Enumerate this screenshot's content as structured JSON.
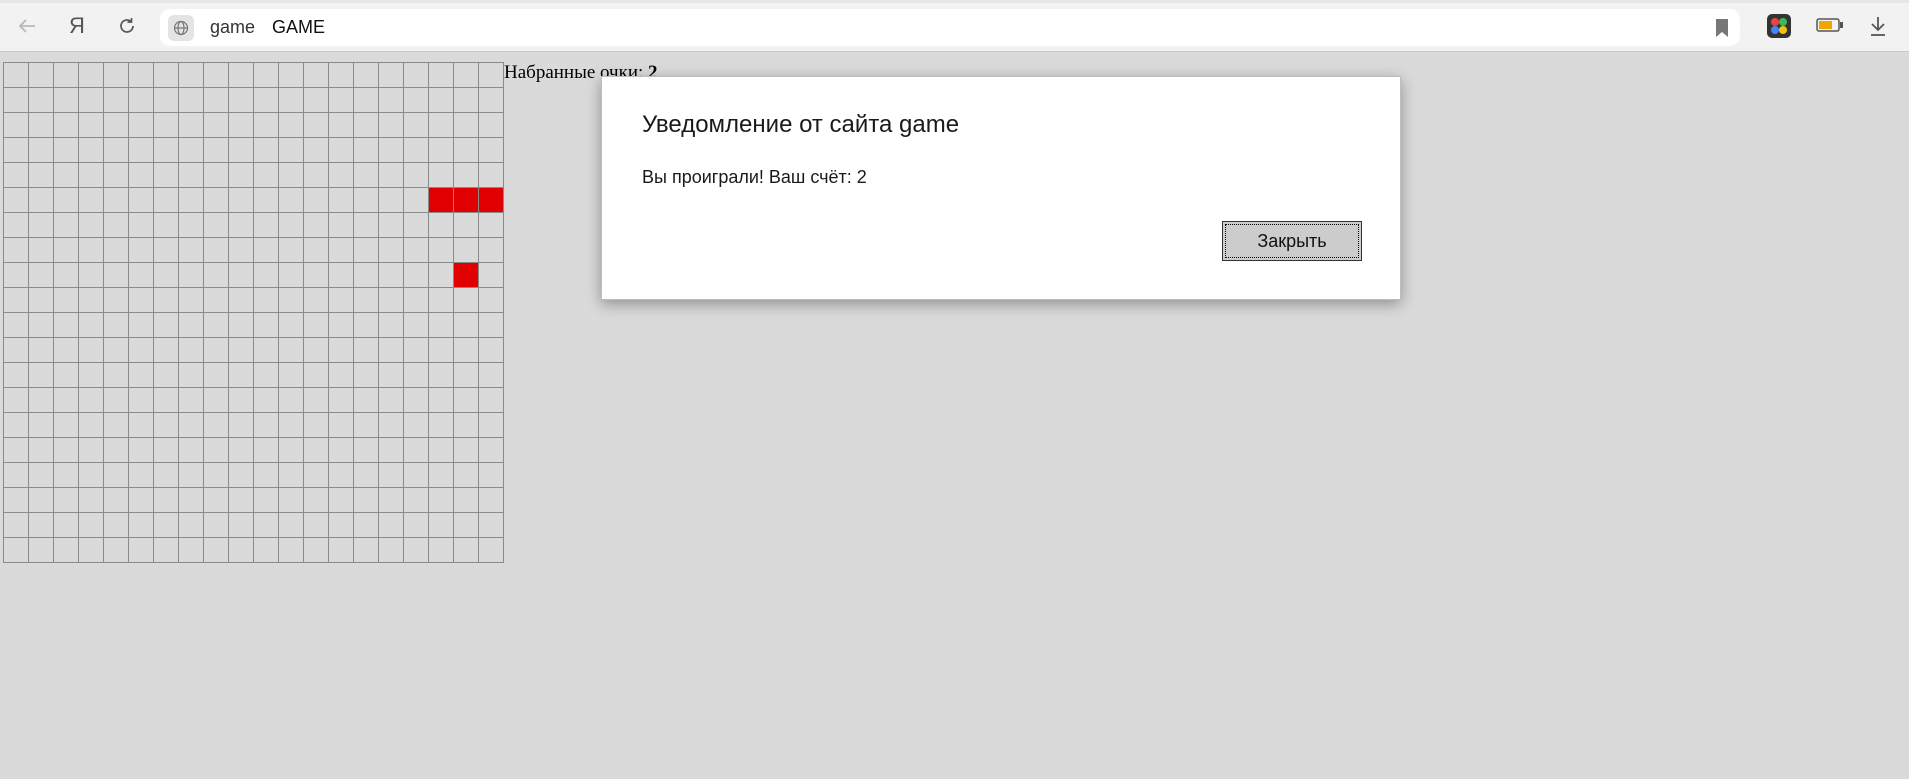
{
  "browser": {
    "address_host": "game",
    "page_title": "GAME",
    "back_icon": "back-arrow-icon",
    "yandex_icon_glyph": "Я",
    "reload_icon": "reload-icon",
    "bookmark_icon": "bookmark-icon",
    "extension_icon": "color-cube-icon",
    "battery_icon": "battery-icon",
    "download_icon": "download-icon"
  },
  "game": {
    "score_label": "Набранные очки:",
    "score_value": "2",
    "grid_cols": 20,
    "grid_rows": 20,
    "cell_color": "#dadada",
    "snake_color": "#e00000",
    "snake_cells": [
      [
        17,
        5
      ],
      [
        18,
        5
      ],
      [
        19,
        5
      ]
    ],
    "food_cells": [
      [
        18,
        8
      ]
    ]
  },
  "dialog": {
    "title": "Уведомление от сайта game",
    "message": "Вы проиграли! Ваш счёт: 2",
    "close_label": "Закрыть"
  }
}
